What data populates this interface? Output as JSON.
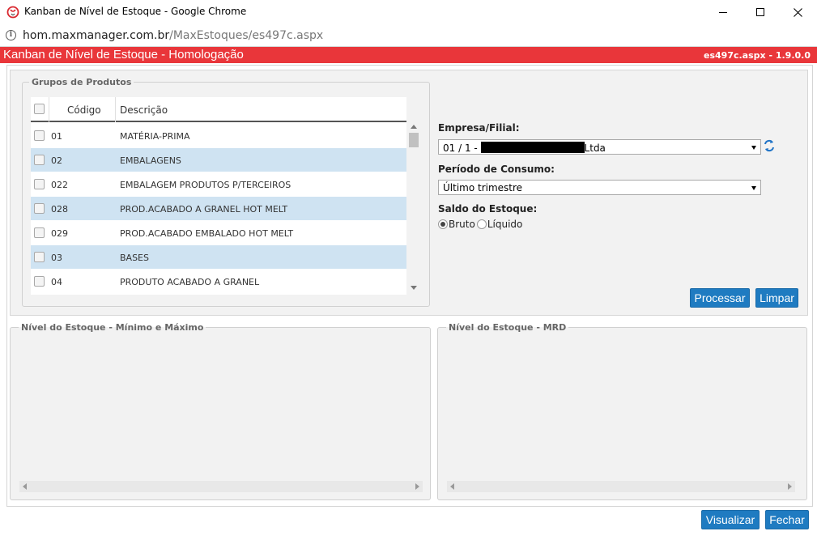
{
  "window": {
    "title": "Kanban de Nível de Estoque - Google Chrome"
  },
  "urlbar": {
    "host": "hom.maxmanager.com.br",
    "path": "/MaxEstoques/es497c.aspx"
  },
  "header": {
    "title": "Kanban de Nível de Estoque - Homologação",
    "version": "es497c.aspx - 1.9.0.0",
    "color": "#e9363a"
  },
  "grupos": {
    "legend": "Grupos de Produtos",
    "columns": [
      "Código",
      "Descrição"
    ],
    "rows": [
      {
        "codigo": "01",
        "descricao": "MATÉRIA-PRIMA"
      },
      {
        "codigo": "02",
        "descricao": "EMBALAGENS"
      },
      {
        "codigo": "022",
        "descricao": "EMBALAGEM PRODUTOS P/TERCEIROS"
      },
      {
        "codigo": "028",
        "descricao": "PROD.ACABADO A GRANEL HOT MELT"
      },
      {
        "codigo": "029",
        "descricao": "PROD.ACABADO EMBALADO HOT MELT"
      },
      {
        "codigo": "03",
        "descricao": "BASES"
      },
      {
        "codigo": "04",
        "descricao": "PRODUTO ACABADO A GRANEL"
      }
    ]
  },
  "form": {
    "empresa_label": "Empresa/Filial:",
    "empresa_prefix": "01 / 1 - ",
    "empresa_suffix": "Ltda",
    "periodo_label": "Período de Consumo:",
    "periodo_value": "Último trimestre",
    "saldo_label": "Saldo do Estoque:",
    "saldo_bruto": "Bruto",
    "saldo_liquido": "Líquido",
    "processar": "Processar",
    "limpar": "Limpar"
  },
  "panels": {
    "min_max": "Nível do Estoque - Mínimo e Máximo",
    "mrd": "Nível do Estoque - MRD"
  },
  "footer": {
    "visualizar": "Visualizar",
    "fechar": "Fechar"
  },
  "colors": {
    "accent_button": "#1f7bc1",
    "row_alt": "#cfe3f2"
  }
}
